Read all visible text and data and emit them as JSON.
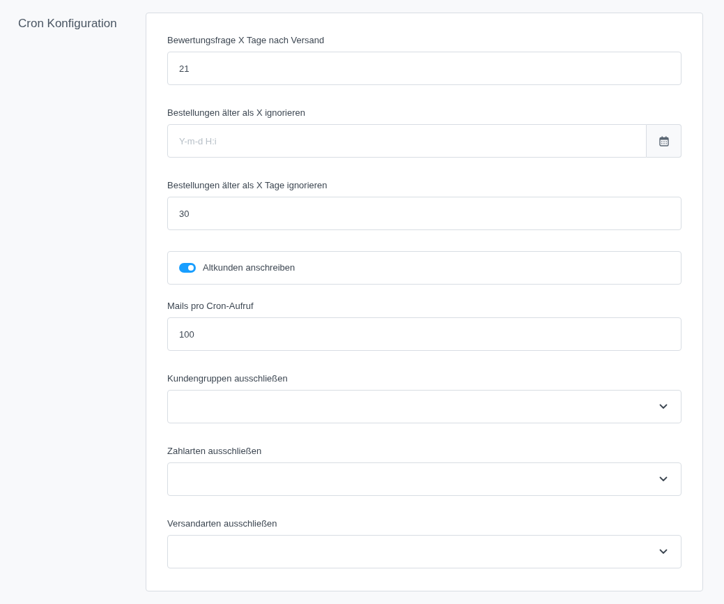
{
  "section_title": "Cron Konfiguration",
  "fields": [
    {
      "kind": "text",
      "label": "Bewertungsfrage X Tage nach Versand",
      "value": "21"
    },
    {
      "kind": "date",
      "label": "Bestellungen älter als X ignorieren",
      "placeholder": "Y-m-d H:i"
    },
    {
      "kind": "text",
      "label": "Bestellungen älter als X Tage ignorieren",
      "value": "30"
    },
    {
      "kind": "switch",
      "label": "Altkunden anschreiben",
      "on": true
    },
    {
      "kind": "text",
      "label": "Mails pro Cron-Aufruf",
      "value": "100"
    },
    {
      "kind": "select",
      "label": "Kundengruppen ausschließen"
    },
    {
      "kind": "select",
      "label": "Zahlarten ausschließen"
    },
    {
      "kind": "select",
      "label": "Versandarten ausschließen"
    }
  ]
}
